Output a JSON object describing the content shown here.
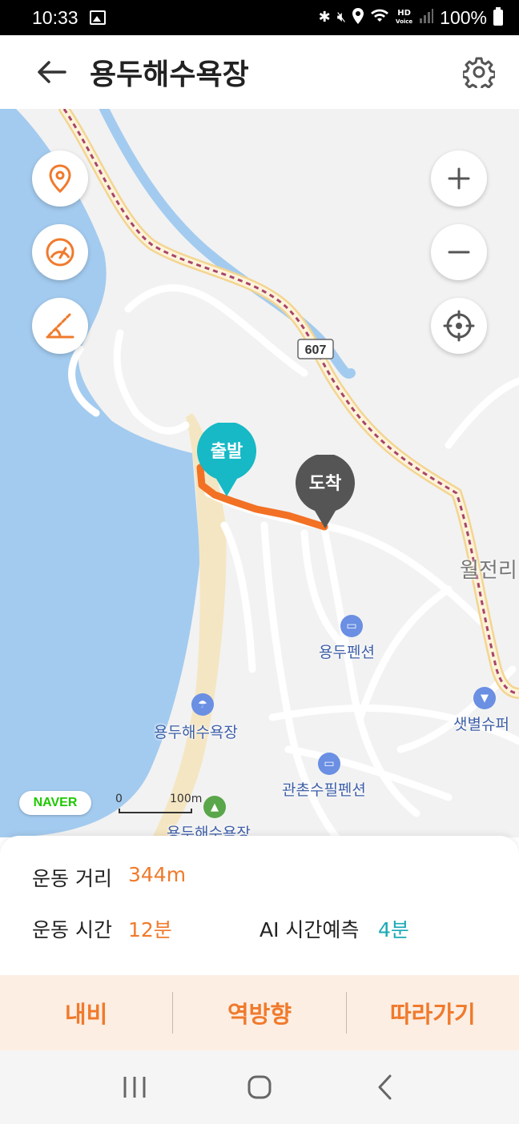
{
  "status_bar": {
    "time": "10:33",
    "battery": "100%",
    "hd_label": "HD",
    "hd_sub": "Voice"
  },
  "header": {
    "title": "용두해수욕장",
    "back_icon": "arrow-left-icon",
    "settings_icon": "gear-icon"
  },
  "map": {
    "road_number": "607",
    "start_pin_label": "출발",
    "end_pin_label": "도착",
    "places": {
      "yongdu_pension": "용두펜션",
      "yongdu_beach": "용두해수욕장",
      "gwanchon_pension": "관촌수필펜션",
      "star_super": "샛별슈퍼",
      "woljeon": "월전리",
      "yongdu_camp": "용두해수욕장"
    },
    "naver_logo": "NAVER",
    "scale_zero": "0",
    "scale_distance": "100m",
    "route_color": "#f27124",
    "start_color": "#16b9c5",
    "end_color": "#555555"
  },
  "stats": {
    "distance_label": "운동 거리",
    "distance_value": "344m",
    "time_label": "운동 시간",
    "time_value": "12분",
    "ai_label": "AI 시간예측",
    "ai_value": "4분",
    "accent_orange": "#f07a2c",
    "accent_teal": "#1aa9b7"
  },
  "actions": {
    "navi": "내비",
    "reverse": "역방향",
    "follow": "따라가기"
  }
}
